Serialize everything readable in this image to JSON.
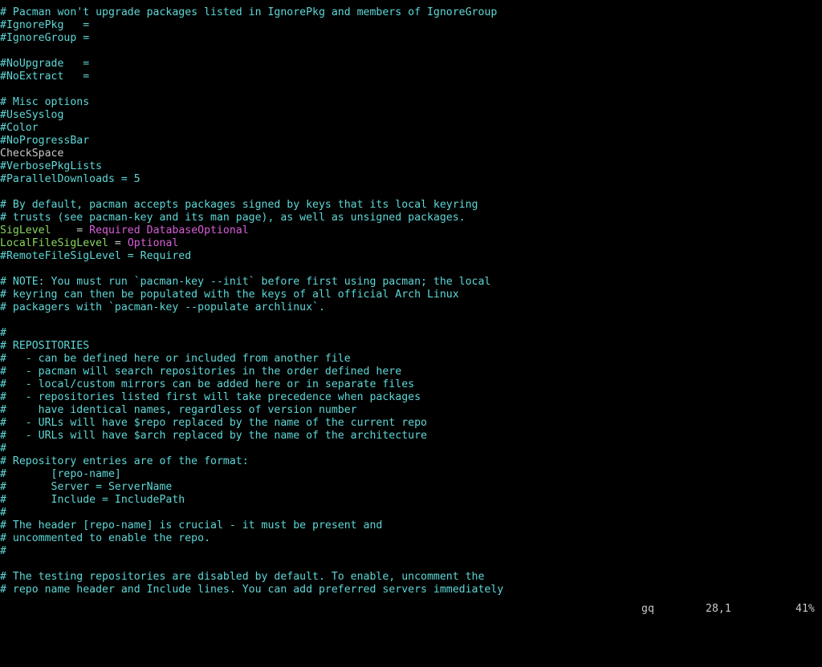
{
  "colors": {
    "background": "#000000",
    "comment": "#5fd7d7",
    "keyword": "#87d75f",
    "value": "#d75fd7",
    "plain": "#c8c8c8"
  },
  "editor": {
    "lines": [
      [
        {
          "t": "# Pacman won't upgrade packages listed in IgnorePkg and members of IgnoreGroup",
          "s": "c"
        }
      ],
      [
        {
          "t": "#IgnorePkg   =",
          "s": "c"
        }
      ],
      [
        {
          "t": "#IgnoreGroup =",
          "s": "c"
        }
      ],
      [],
      [
        {
          "t": "#NoUpgrade   =",
          "s": "c"
        }
      ],
      [
        {
          "t": "#NoExtract   =",
          "s": "c"
        }
      ],
      [],
      [
        {
          "t": "# Misc options",
          "s": "c"
        }
      ],
      [
        {
          "t": "#UseSyslog",
          "s": "c"
        }
      ],
      [
        {
          "t": "#Color",
          "s": "c"
        }
      ],
      [
        {
          "t": "#NoProgressBar",
          "s": "c"
        }
      ],
      [
        {
          "t": "CheckSpace",
          "s": "p"
        }
      ],
      [
        {
          "t": "#VerbosePkgLists",
          "s": "c"
        }
      ],
      [
        {
          "t": "#ParallelDownloads = 5",
          "s": "c"
        }
      ],
      [],
      [
        {
          "t": "# By default, pacman accepts packages signed by keys that its local keyring",
          "s": "c"
        }
      ],
      [
        {
          "t": "# trusts (see pacman-key and its man page), as well as unsigned packages.",
          "s": "c"
        }
      ],
      [
        {
          "t": "SigLevel",
          "s": "k"
        },
        {
          "t": "    = ",
          "s": "p"
        },
        {
          "t": "Required DatabaseOptional",
          "s": "v"
        }
      ],
      [
        {
          "t": "LocalFileSigLevel",
          "s": "k"
        },
        {
          "t": " = ",
          "s": "p"
        },
        {
          "t": "Optional",
          "s": "v"
        }
      ],
      [
        {
          "t": "#RemoteFileSigLevel = Required",
          "s": "c"
        }
      ],
      [],
      [
        {
          "t": "# NOTE: You must run `pacman-key --init` before first using pacman; the local",
          "s": "c"
        }
      ],
      [
        {
          "t": "# keyring can then be populated with the keys of all official Arch Linux",
          "s": "c"
        }
      ],
      [
        {
          "t": "# packagers with `pacman-key --populate archlinux`.",
          "s": "c"
        }
      ],
      [],
      [
        {
          "t": "#",
          "s": "c"
        }
      ],
      [
        {
          "t": "# REPOSITORIES",
          "s": "c"
        }
      ],
      [
        {
          "t": "#   - can be defined here or included from another file",
          "s": "c"
        }
      ],
      [
        {
          "t": "#   - pacman will search repositories in the order defined here",
          "s": "c"
        }
      ],
      [
        {
          "t": "#   - local/custom mirrors can be added here or in separate files",
          "s": "c"
        }
      ],
      [
        {
          "t": "#   - repositories listed first will take precedence when packages",
          "s": "c"
        }
      ],
      [
        {
          "t": "#     have identical names, regardless of version number",
          "s": "c"
        }
      ],
      [
        {
          "t": "#   - URLs will have $repo replaced by the name of the current repo",
          "s": "c"
        }
      ],
      [
        {
          "t": "#   - URLs will have $arch replaced by the name of the architecture",
          "s": "c"
        }
      ],
      [
        {
          "t": "#",
          "s": "c"
        }
      ],
      [
        {
          "t": "# Repository entries are of the format:",
          "s": "c"
        }
      ],
      [
        {
          "t": "#       [repo-name]",
          "s": "c"
        }
      ],
      [
        {
          "t": "#       Server = ServerName",
          "s": "c"
        }
      ],
      [
        {
          "t": "#       Include = IncludePath",
          "s": "c"
        }
      ],
      [
        {
          "t": "#",
          "s": "c"
        }
      ],
      [
        {
          "t": "# The header [repo-name] is crucial - it must be present and",
          "s": "c"
        }
      ],
      [
        {
          "t": "# uncommented to enable the repo.",
          "s": "c"
        }
      ],
      [
        {
          "t": "#",
          "s": "c"
        }
      ],
      [],
      [
        {
          "t": "# The testing repositories are disabled by default. To enable, uncomment the",
          "s": "c"
        }
      ],
      [
        {
          "t": "# repo name header and Include lines. You can add preferred servers immediately",
          "s": "c"
        }
      ]
    ]
  },
  "statusline": {
    "command": "gq",
    "position": "28,1",
    "percent": "41%"
  }
}
